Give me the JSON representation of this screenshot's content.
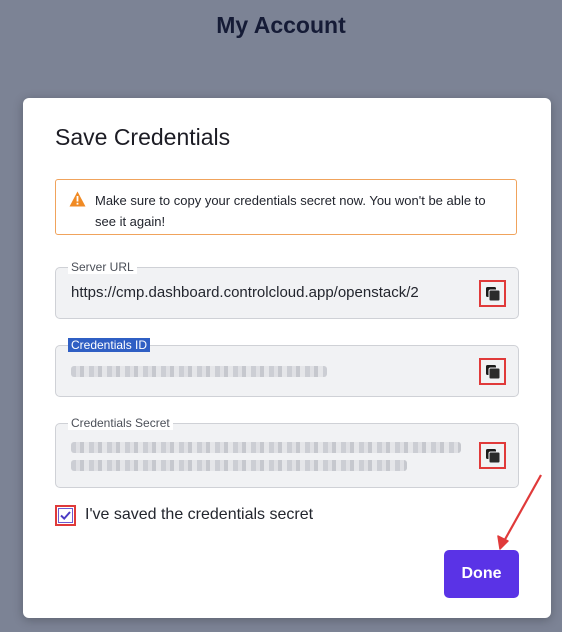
{
  "page": {
    "title": "My Account"
  },
  "modal": {
    "title": "Save Credentials",
    "alert": {
      "icon": "warning-icon",
      "text": "Make sure to copy your credentials secret now. You won't be able to see it again!"
    },
    "fields": {
      "server_url": {
        "label": "Server URL",
        "value": "https://cmp.dashboard.controlcloud.app/openstack/2"
      },
      "credentials_id": {
        "label": "Credentials ID"
      },
      "credentials_secret": {
        "label": "Credentials Secret"
      }
    },
    "copy_icon": "copy-icon",
    "checkbox": {
      "label": "I've saved the credentials secret",
      "checked": true
    },
    "done_label": "Done"
  },
  "colors": {
    "backdrop": "#7c8395",
    "accent": "#5a33e6",
    "warning": "#f0a35c",
    "highlight": "#e03a3a"
  }
}
